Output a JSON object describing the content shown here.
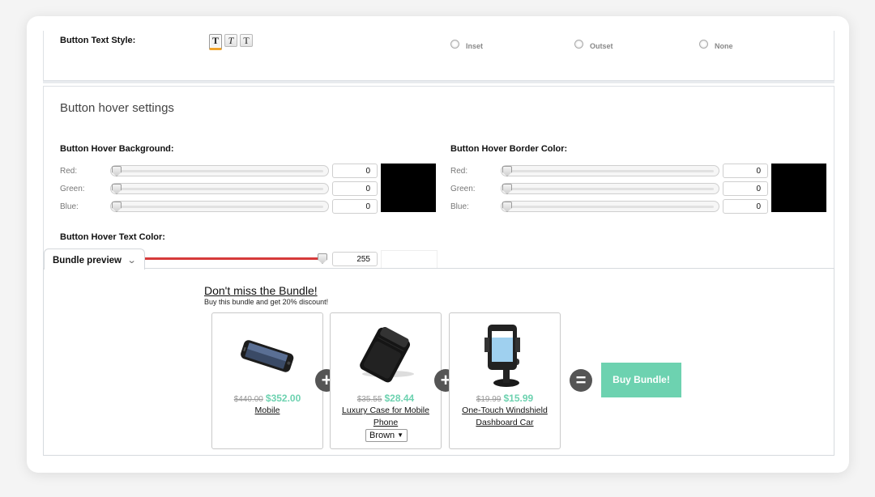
{
  "text_style": {
    "label": "Button Text Style:",
    "buttons": [
      "T",
      "T",
      "T"
    ],
    "border_options": [
      "Inset",
      "Outset",
      "None"
    ]
  },
  "hover": {
    "title": "Button hover settings",
    "background": {
      "label": "Button Hover Background:",
      "rows": [
        {
          "label": "Red:",
          "value": "0"
        },
        {
          "label": "Green:",
          "value": "0"
        },
        {
          "label": "Blue:",
          "value": "0"
        }
      ],
      "color": "#000000"
    },
    "border": {
      "label": "Button Hover Border Color:",
      "rows": [
        {
          "label": "Red:",
          "value": "0"
        },
        {
          "label": "Green:",
          "value": "0"
        },
        {
          "label": "Blue:",
          "value": "0"
        }
      ],
      "color": "#000000"
    },
    "text_color": {
      "label": "Button Hover Text Color:",
      "red_value": "255"
    }
  },
  "preview": {
    "tab_label": "Bundle preview",
    "title": "Don't miss the Bundle!",
    "subtitle": "Buy this bundle and get 20% discount!",
    "products": [
      {
        "old_price": "$440.00",
        "new_price": "$352.00",
        "name": "Mobile",
        "icon": "phone-image"
      },
      {
        "old_price": "$35.55",
        "new_price": "$28.44",
        "name": "Luxury Case for Mobile Phone",
        "icon": "leather-case-image",
        "option": "Brown"
      },
      {
        "old_price": "$19.99",
        "new_price": "$15.99",
        "name": "One-Touch Windshield Dashboard Car",
        "icon": "car-mount-image"
      }
    ],
    "plus": "+",
    "equals": "=",
    "buy_label": "Buy Bundle!",
    "accent": "#6dd2b0"
  }
}
